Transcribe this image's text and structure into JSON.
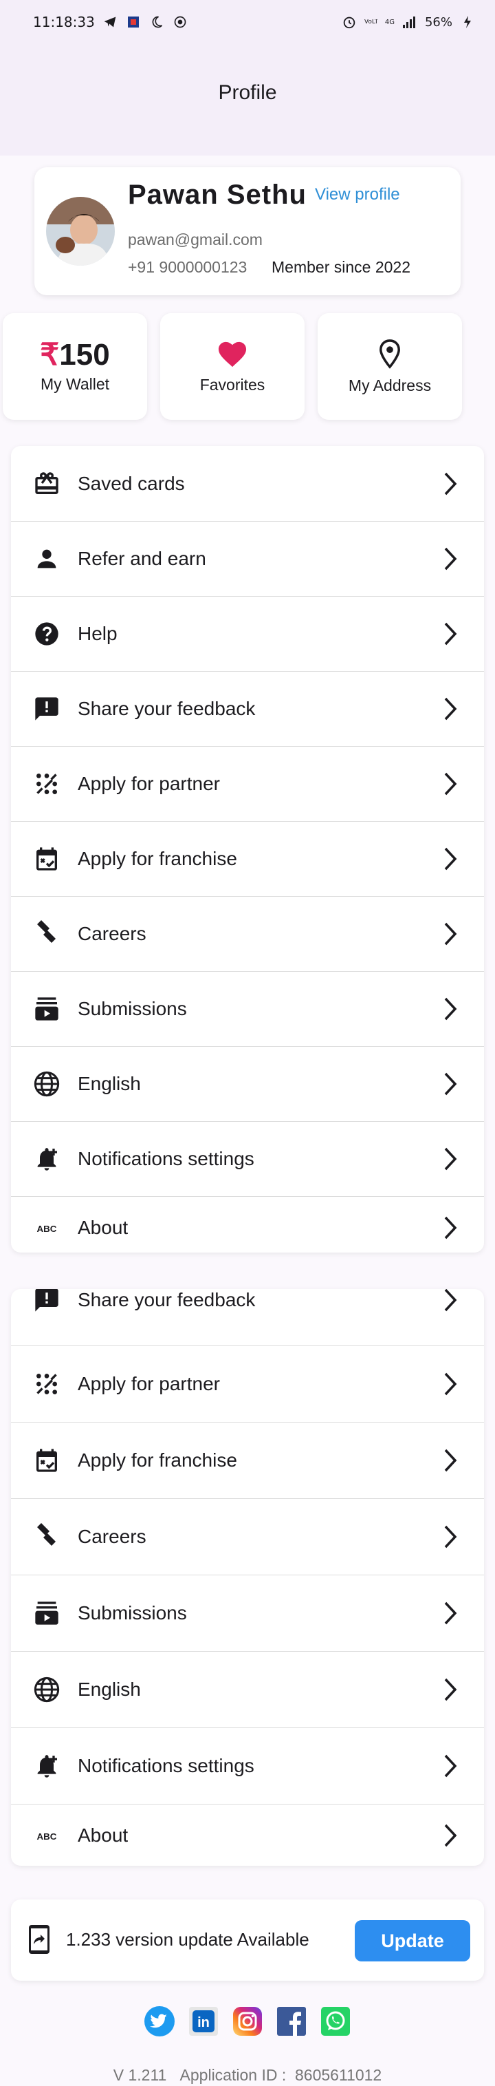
{
  "status_bar": {
    "time": "11:18:33",
    "icons_left": [
      "telegram-icon",
      "app-icon",
      "moon-icon",
      "target-icon"
    ],
    "icons_right": [
      "alarm-icon",
      "volte-icon",
      "signal-icon"
    ],
    "battery": "56%",
    "network_top": "4G",
    "network_side": "VoLTE"
  },
  "app_bar": {
    "title": "Profile"
  },
  "profile": {
    "name": "Pawan Sethu",
    "view_profile_label": "View profile",
    "email": "pawan@gmail.com",
    "phone": "+91 9000000123",
    "member_since": "Member since 2022"
  },
  "stats": {
    "wallet": {
      "currency": "₹",
      "amount": "150",
      "label": "My Wallet"
    },
    "favorites": {
      "label": "Favorites",
      "icon": "heart-icon"
    },
    "address": {
      "label": "My Address",
      "icon": "location-pin-icon"
    }
  },
  "menu_primary": [
    {
      "label": "Saved cards",
      "icon": "gift-card-icon"
    },
    {
      "label": "Refer and earn",
      "icon": "person-icon"
    },
    {
      "label": "Help",
      "icon": "help-icon"
    },
    {
      "label": "Share your feedback",
      "icon": "feedback-icon"
    },
    {
      "label": "Apply for partner",
      "icon": "partner-icon"
    },
    {
      "label": "Apply for franchise",
      "icon": "calendar-check-icon"
    },
    {
      "label": "Careers",
      "icon": "careers-icon"
    },
    {
      "label": "Submissions",
      "icon": "subscriptions-icon"
    },
    {
      "label": "English",
      "icon": "globe-icon"
    },
    {
      "label": "Notifications settings",
      "icon": "bell-add-icon"
    },
    {
      "label": "About",
      "icon": "abc-icon"
    }
  ],
  "menu_secondary": [
    {
      "label": "Share your feedback",
      "icon": "feedback-icon"
    },
    {
      "label": "Apply for partner",
      "icon": "partner-icon"
    },
    {
      "label": "Apply for franchise",
      "icon": "calendar-check-icon"
    },
    {
      "label": "Careers",
      "icon": "careers-icon"
    },
    {
      "label": "Submissions",
      "icon": "subscriptions-icon"
    },
    {
      "label": "English",
      "icon": "globe-icon"
    },
    {
      "label": "Notifications settings",
      "icon": "bell-add-icon"
    },
    {
      "label": "About",
      "icon": "abc-icon"
    }
  ],
  "update": {
    "text": "1.233 version update Available",
    "button_label": "Update"
  },
  "socials": [
    "twitter-icon",
    "linkedin-icon",
    "instagram-icon",
    "facebook-icon",
    "whatsapp-icon"
  ],
  "footer": {
    "version": "V 1.211",
    "application_id_label": "Application ID :",
    "application_id": "8605611012"
  },
  "colors": {
    "accent_blue": "#2d8ef0",
    "link_blue": "#2f8fd6",
    "heart_pink": "#e0245e",
    "header_bg": "#f4eef9"
  }
}
